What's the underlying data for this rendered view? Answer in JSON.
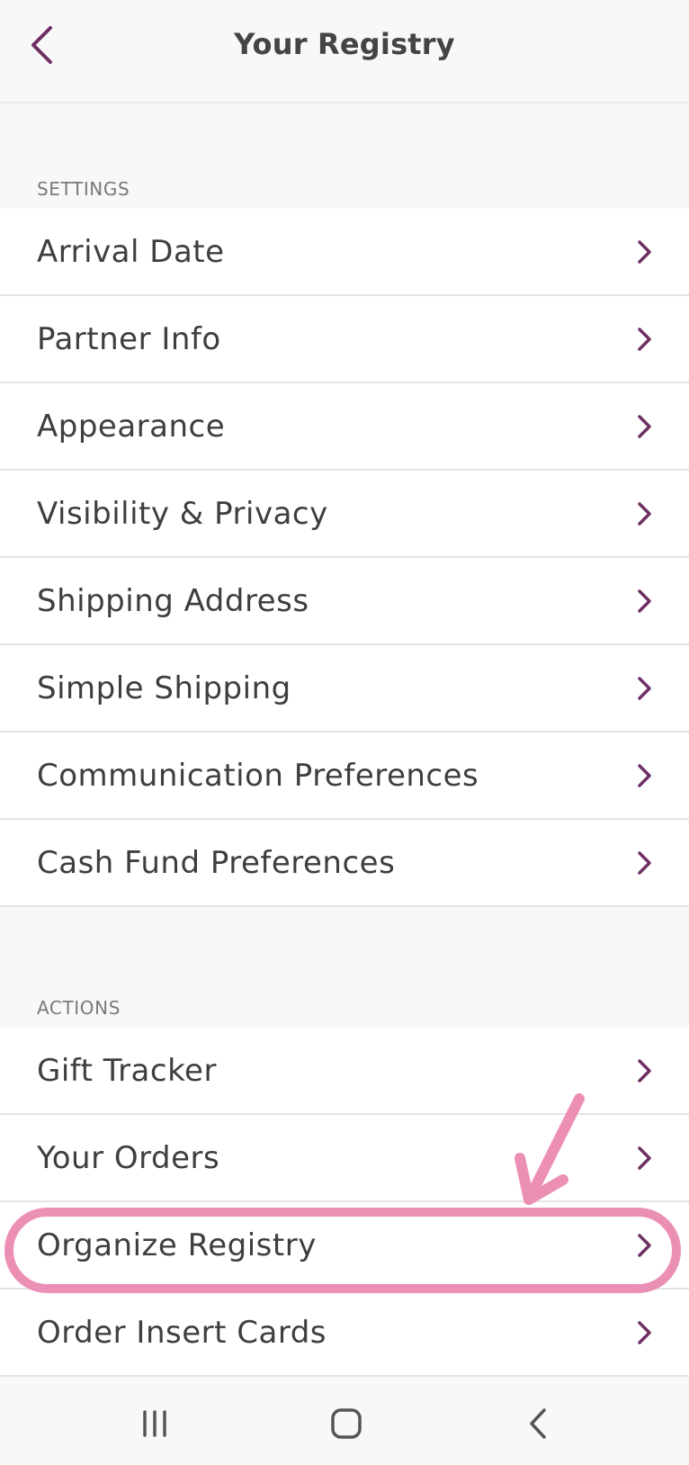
{
  "header": {
    "title": "Your Registry"
  },
  "colors": {
    "accent": "#6e2f63",
    "highlight": "#ec8fb5",
    "background": "#f8f8f8"
  },
  "settings": {
    "label": "SETTINGS",
    "items": [
      {
        "label": "Arrival Date"
      },
      {
        "label": "Partner Info"
      },
      {
        "label": "Appearance"
      },
      {
        "label": "Visibility & Privacy"
      },
      {
        "label": "Shipping Address"
      },
      {
        "label": "Simple Shipping"
      },
      {
        "label": "Communication Preferences"
      },
      {
        "label": "Cash Fund Preferences"
      }
    ]
  },
  "actions": {
    "label": "ACTIONS",
    "items": [
      {
        "label": "Gift Tracker"
      },
      {
        "label": "Your Orders"
      },
      {
        "label": "Organize Registry"
      },
      {
        "label": "Order Insert Cards"
      }
    ]
  },
  "icons": {
    "back": "chevron-left-icon",
    "row": "chevron-right-icon",
    "nav_recents": "recents-icon",
    "nav_home": "home-icon",
    "nav_back": "back-icon"
  }
}
